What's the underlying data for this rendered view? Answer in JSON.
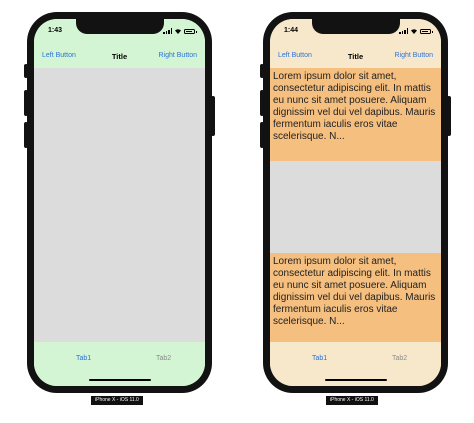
{
  "devices": [
    {
      "time": "1:43",
      "nav": {
        "left_button": "Left Button",
        "title": "Title",
        "right_button": "Right Button"
      },
      "tabs": [
        "Tab1",
        "Tab2"
      ],
      "caption": "iPhone X - iOS 11.0",
      "theme": {
        "bar_color": "#d3f5d3",
        "content_color": "#dcdcdc"
      }
    },
    {
      "time": "1:44",
      "nav": {
        "left_button": "Left Button",
        "title": "Title",
        "right_button": "Right Button"
      },
      "tabs": [
        "Tab1",
        "Tab2"
      ],
      "caption": "iPhone X - iOS 11.0",
      "theme": {
        "bar_color": "#f8e8cb",
        "content_color": "#dcdcdc",
        "text_block_color": "#f5bf7f"
      },
      "text_blocks": [
        "Lorem ipsum dolor sit amet, consectetur adipiscing elit. In mattis eu nunc sit amet posuere. Aliquam dignissim vel dui vel dapibus. Mauris fermentum iaculis eros vitae scelerisque. N...",
        "Lorem ipsum dolor sit amet, consectetur adipiscing elit. In mattis eu nunc sit amet posuere. Aliquam dignissim vel dui vel dapibus. Mauris fermentum iaculis eros vitae scelerisque. N..."
      ]
    }
  ],
  "icons": [
    "signal-icon",
    "wifi-icon",
    "battery-icon"
  ],
  "accent_color": "#2c72d8"
}
